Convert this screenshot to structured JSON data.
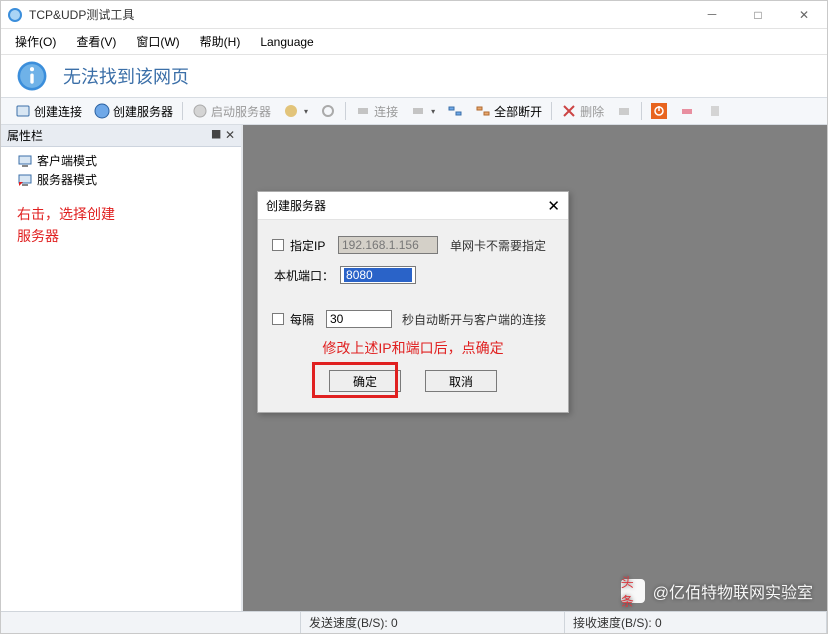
{
  "window": {
    "title": "TCP&UDP测试工具",
    "controls": {
      "min": "－",
      "max": "□",
      "close": "✕"
    }
  },
  "menu": {
    "operate": "操作(O)",
    "view": "查看(V)",
    "window": "窗口(W)",
    "help": "帮助(H)",
    "language": "Language"
  },
  "banner": {
    "message": "无法找到该网页"
  },
  "toolbar": {
    "create_conn": "创建连接",
    "create_server": "创建服务器",
    "start_server": "启动服务器",
    "connect": "连接",
    "disconnect_all": "全部断开",
    "delete": "删除"
  },
  "sidebar": {
    "title": "属性栏",
    "pin": "✕",
    "nodes": {
      "client_mode": "客户端模式",
      "server_mode": "服务器模式"
    },
    "annotation_line1": "右击，选择创建",
    "annotation_line2": "服务器"
  },
  "dialog": {
    "title": "创建服务器",
    "specify_ip_label": "指定IP",
    "ip_value": "192.168.1.156",
    "ip_hint": "单网卡不需要指定",
    "local_port_label": "本机端口：",
    "port_value": "8080",
    "interval_label": "每隔",
    "interval_value": "30",
    "interval_hint": "秒自动断开与客户端的连接",
    "red_note": "修改上述IP和端口后，点确定",
    "ok": "确定",
    "cancel": "取消",
    "close": "✕"
  },
  "status": {
    "send_speed": "发送速度(B/S): 0",
    "recv_speed": "接收速度(B/S): 0"
  },
  "watermark": {
    "badge": "头条",
    "text": "@亿佰特物联网实验室"
  }
}
